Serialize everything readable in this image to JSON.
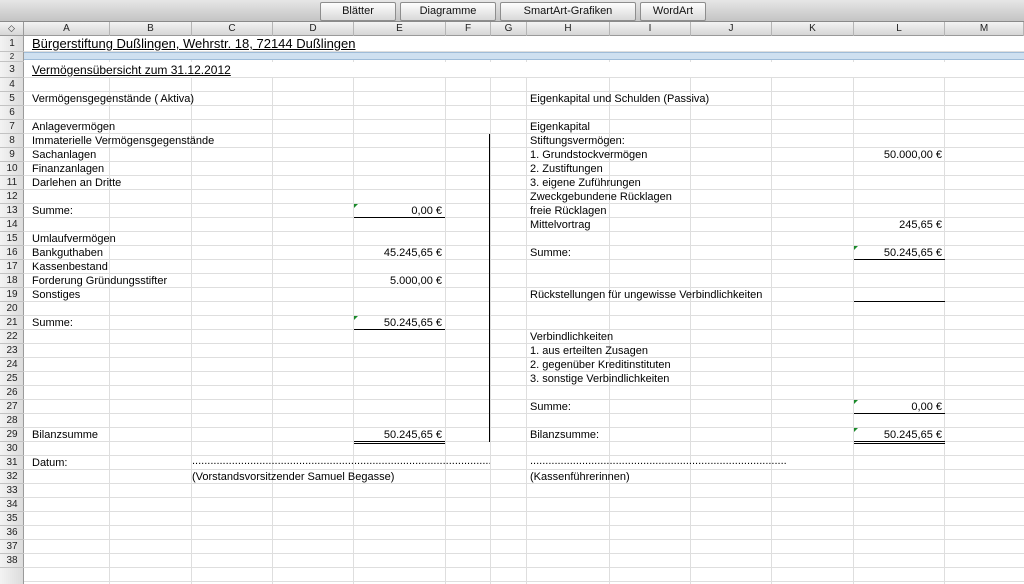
{
  "toolbar": {
    "tabs": [
      "Blätter",
      "Diagramme",
      "SmartArt-Grafiken",
      "WordArt"
    ]
  },
  "sheet": {
    "corner_glyph": "◇",
    "columns": [
      "A",
      "B",
      "C",
      "D",
      "E",
      "F",
      "G",
      "H",
      "I",
      "J",
      "K",
      "L",
      "M"
    ],
    "rows": [
      "1",
      "2",
      "3",
      "4",
      "5",
      "6",
      "7",
      "8",
      "9",
      "10",
      "11",
      "12",
      "13",
      "14",
      "15",
      "16",
      "17",
      "18",
      "19",
      "20",
      "21",
      "22",
      "23",
      "24",
      "25",
      "26",
      "27",
      "28",
      "29",
      "30",
      "31",
      "32",
      "33",
      "34",
      "35",
      "36",
      "37",
      "38"
    ]
  },
  "cells": {
    "title": "Bürgerstiftung Dußlingen, Wehrstr. 18, 72144 Dußlingen",
    "subtitle": "Vermögensübersicht zum 31.12.2012",
    "aktiva_header": "Vermögensgegenstände ( Aktiva)",
    "passiva_header": "Eigenkapital und Schulden (Passiva)",
    "a7": "Anlagevermögen",
    "a8": "Immaterielle Vermögensgegenstände",
    "a9": "Sachanlagen",
    "a10": "Finanzanlagen",
    "a11": "Darlehen an Dritte",
    "a13": "Summe:",
    "e13": "0,00 €",
    "a15": "Umlaufvermögen",
    "a16": "Bankguthaben",
    "e16": "45.245,65 €",
    "a17": "Kassenbestand",
    "a18": "Forderung Gründungsstifter",
    "e18": "5.000,00 €",
    "a19": "Sonstiges",
    "a21": "Summe:",
    "e21": "50.245,65 €",
    "a29": "Bilanzsumme",
    "e29": "50.245,65 €",
    "a31": "Datum:",
    "c32": "(Vorstandsvorsitzender Samuel Begasse)",
    "h7": "Eigenkapital",
    "h8": "Stiftungsvermögen:",
    "h9": "1. Grundstockvermögen",
    "l9": "50.000,00 €",
    "h10": "2. Zustiftungen",
    "h11": "3. eigene Zuführungen",
    "h12": "Zweckgebundene Rücklagen",
    "h13": "freie Rücklagen",
    "h14": "Mittelvortrag",
    "l14": "245,65 €",
    "h16": "Summe:",
    "l16": "50.245,65 €",
    "h19": "Rückstellungen für ungewisse Verbindlichkeiten",
    "h22": "Verbindlichkeiten",
    "h23": "1. aus erteilten Zusagen",
    "h24": "2. gegenüber Kreditinstituten",
    "h25": "3. sonstige Verbindlichkeiten",
    "h27": "Summe:",
    "l27": "0,00 €",
    "h29": "Bilanzsumme:",
    "l29": "50.245,65 €",
    "h32": "(Kassenführerinnen)",
    "signature_dots": "..............................................................................................................................................................."
  },
  "colors": {
    "note_triangle": "#1a8a2a",
    "row2_band": "#cfe0f0"
  }
}
